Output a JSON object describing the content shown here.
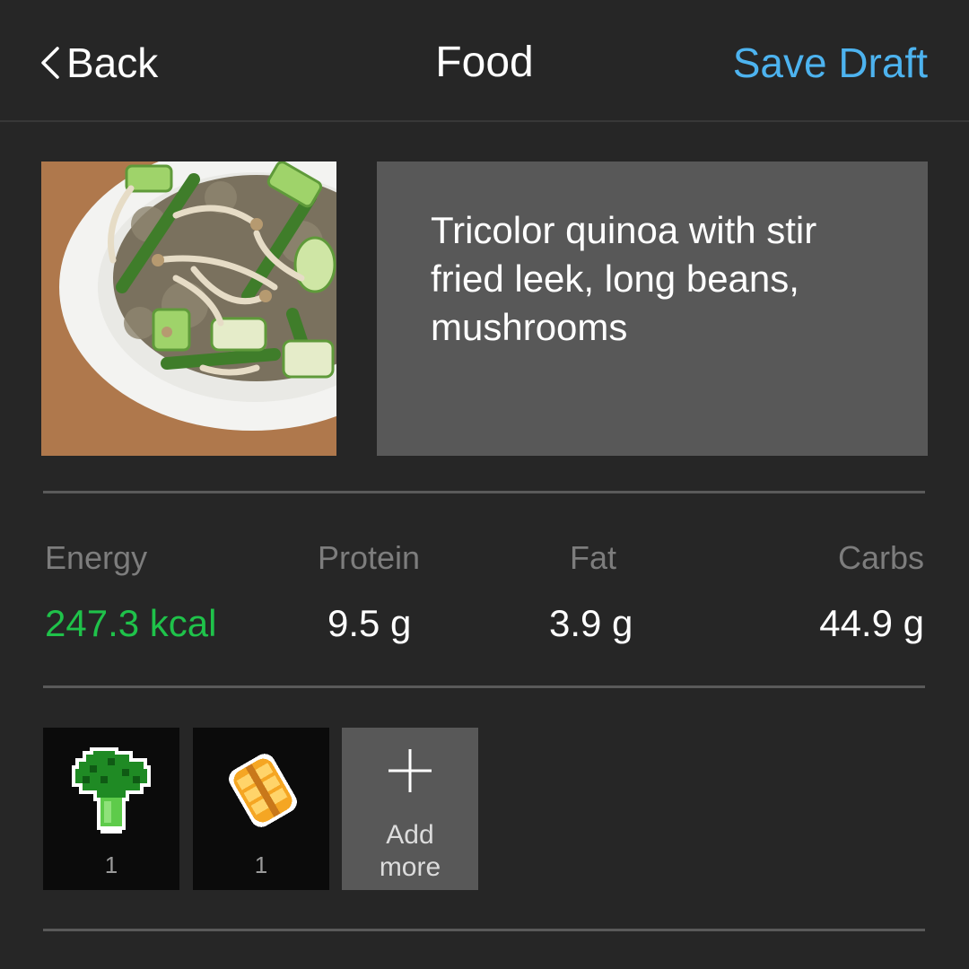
{
  "nav": {
    "back_label": "Back",
    "title": "Food",
    "save_label": "Save Draft"
  },
  "food": {
    "description": "Tricolor quinoa with stir fried leek, long beans, mushrooms"
  },
  "nutrition": {
    "energy": {
      "label": "Energy",
      "value": "247.3 kcal"
    },
    "protein": {
      "label": "Protein",
      "value": "9.5 g"
    },
    "fat": {
      "label": "Fat",
      "value": "3.9 g"
    },
    "carbs": {
      "label": "Carbs",
      "value": "44.9 g"
    }
  },
  "ingredients": [
    {
      "icon": "broccoli-icon",
      "count": "1"
    },
    {
      "icon": "grain-icon",
      "count": "1"
    }
  ],
  "add_more_label": "Add more",
  "colors": {
    "accent": "#4db3ef",
    "energy": "#1fc24a",
    "background": "#262626"
  }
}
